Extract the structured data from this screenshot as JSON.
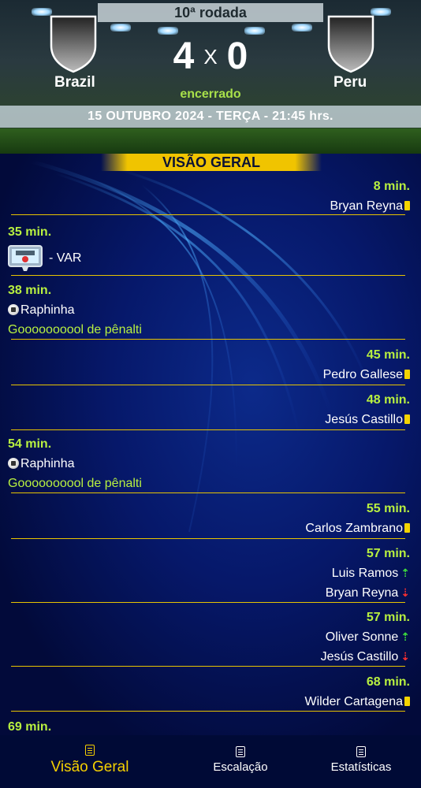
{
  "match": {
    "round": "10ª rodada",
    "home_team": "Brazil",
    "away_team": "Peru",
    "home_score": "4",
    "score_separator": "X",
    "away_score": "0",
    "status": "encerrado",
    "date_line": "15 OUTUBRO 2024 - TERÇA - 21:45 hrs."
  },
  "section_title": "VISÃO GERAL",
  "events": [
    {
      "time": "8 min.",
      "side": "right",
      "line1": "Bryan Reyna",
      "icon1": "yellow-card-icon"
    },
    {
      "time": "35 min.",
      "side": "left",
      "var_text": "-  VAR",
      "icon1": "var-monitor-icon"
    },
    {
      "time": "38 min.",
      "side": "left",
      "line1": "Raphinha",
      "icon1": "soccer-ball-icon",
      "note": "Goooooooool de pênalti"
    },
    {
      "time": "45 min.",
      "side": "right",
      "line1": "Pedro Gallese",
      "icon1": "yellow-card-icon"
    },
    {
      "time": "48 min.",
      "side": "right",
      "line1": "Jesús Castillo",
      "icon1": "yellow-card-icon"
    },
    {
      "time": "54 min.",
      "side": "left",
      "line1": "Raphinha",
      "icon1": "soccer-ball-icon",
      "note": "Goooooooool de pênalti"
    },
    {
      "time": "55 min.",
      "side": "right",
      "line1": "Carlos Zambrano",
      "icon1": "yellow-card-icon"
    },
    {
      "time": "57 min.",
      "side": "right",
      "line1": "Luis Ramos",
      "icon1": "sub-in-icon",
      "line2": "Bryan Reyna",
      "icon2": "sub-out-icon"
    },
    {
      "time": "57 min.",
      "side": "right",
      "line1": "Oliver Sonne",
      "icon1": "sub-in-icon",
      "line2": "Jesús Castillo",
      "icon2": "sub-out-icon"
    },
    {
      "time": "68 min.",
      "side": "right",
      "line1": "Wilder Cartagena",
      "icon1": "yellow-card-icon"
    },
    {
      "time": "69 min.",
      "side": "left"
    }
  ],
  "nav": {
    "items": [
      {
        "label": "Visão Geral",
        "icon": "document-icon",
        "active": true
      },
      {
        "label": "Escalação",
        "icon": "document-icon",
        "active": false
      },
      {
        "label": "Estatísticas",
        "icon": "document-icon",
        "active": false
      }
    ]
  },
  "colors": {
    "accent_yellow": "#f0c400",
    "time_green": "#b8f040",
    "background_blue": "#06186a",
    "sub_in": "#3ddc3d",
    "sub_out": "#ff3030"
  }
}
